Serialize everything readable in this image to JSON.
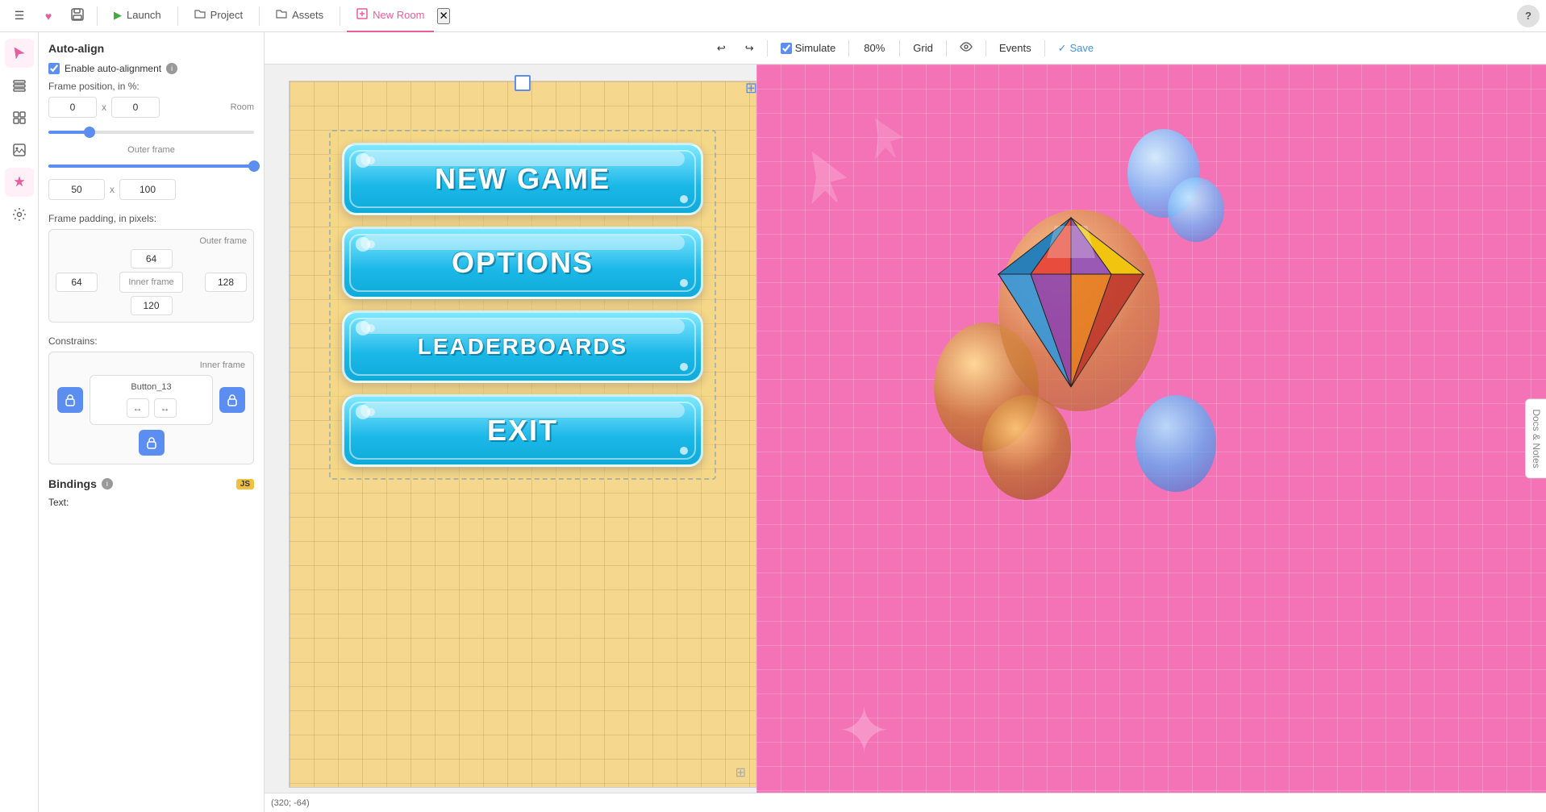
{
  "topbar": {
    "menu_icon": "☰",
    "heart_icon": "♥",
    "save_icon": "💾",
    "launch_label": "Launch",
    "project_label": "Project",
    "assets_label": "Assets",
    "new_room_label": "New Room",
    "help_label": "?"
  },
  "sidebar": {
    "icons": [
      {
        "name": "cursor-icon",
        "symbol": "↖"
      },
      {
        "name": "layers-icon",
        "symbol": "⊞"
      },
      {
        "name": "components-icon",
        "symbol": "⊟"
      },
      {
        "name": "image-icon",
        "symbol": "🖼"
      },
      {
        "name": "magic-icon",
        "symbol": "✦"
      },
      {
        "name": "settings-icon",
        "symbol": "⚙"
      }
    ]
  },
  "panel": {
    "auto_align_title": "Auto-align",
    "enable_auto_alignment_label": "Enable auto-alignment",
    "frame_position_label": "Frame position, in %:",
    "pos_x": "0",
    "pos_y": "0",
    "room_label": "Room",
    "outer_frame_label": "Outer frame",
    "width": "50",
    "height": "100",
    "frame_padding_label": "Frame padding, in pixels:",
    "padding_outer_label": "Outer frame",
    "padding_top": "64",
    "padding_left": "64",
    "padding_right": "128",
    "padding_bottom": "120",
    "inner_frame_label": "Inner frame",
    "constrains_label": "Constrains:",
    "constrains_inner_label": "Inner frame",
    "button_name": "Button_13",
    "bindings_label": "Bindings",
    "bindings_text_label": "Text:"
  },
  "toolbar": {
    "undo_icon": "↩",
    "redo_icon": "↪",
    "simulate_label": "Simulate",
    "zoom_level": "80%",
    "grid_label": "Grid",
    "eye_icon": "👁",
    "events_label": "Events",
    "save_label": "Save"
  },
  "game_buttons": [
    {
      "label": "NEW GAME"
    },
    {
      "label": "OPTIONS"
    },
    {
      "label": "LEADERBOARDS"
    },
    {
      "label": "EXIT"
    }
  ],
  "status_bar": {
    "coordinates": "(320; -64)"
  },
  "docs_notes_label": "Docs & Notes"
}
